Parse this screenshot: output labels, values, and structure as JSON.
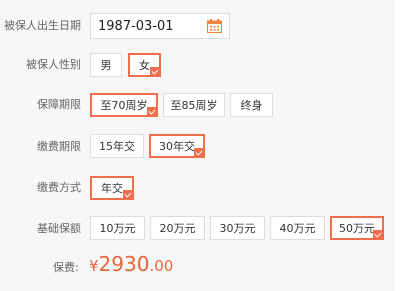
{
  "birth_date": {
    "label": "被保人出生日期",
    "value": "1987-03-01",
    "icon": "calendar-icon"
  },
  "gender": {
    "label": "被保人性别",
    "options": [
      "男",
      "女"
    ],
    "selected": "女"
  },
  "coverage_period": {
    "label": "保障期限",
    "options": [
      "至70周岁",
      "至85周岁",
      "终身"
    ],
    "selected": "至70周岁"
  },
  "payment_period": {
    "label": "缴费期限",
    "options": [
      "15年交",
      "30年交"
    ],
    "selected": "30年交"
  },
  "payment_method": {
    "label": "缴费方式",
    "options": [
      "年交"
    ],
    "selected": "年交"
  },
  "base_amount": {
    "label": "基础保额",
    "options": [
      "10万元",
      "20万元",
      "30万元",
      "40万元",
      "50万元"
    ],
    "selected": "50万元"
  },
  "premium": {
    "label": "保费:",
    "currency": "¥",
    "integer": "2930",
    "decimal": ".00"
  },
  "colors": {
    "accent": "#f26d4d",
    "price": "#e8643a",
    "background": "#f7f7f7"
  }
}
